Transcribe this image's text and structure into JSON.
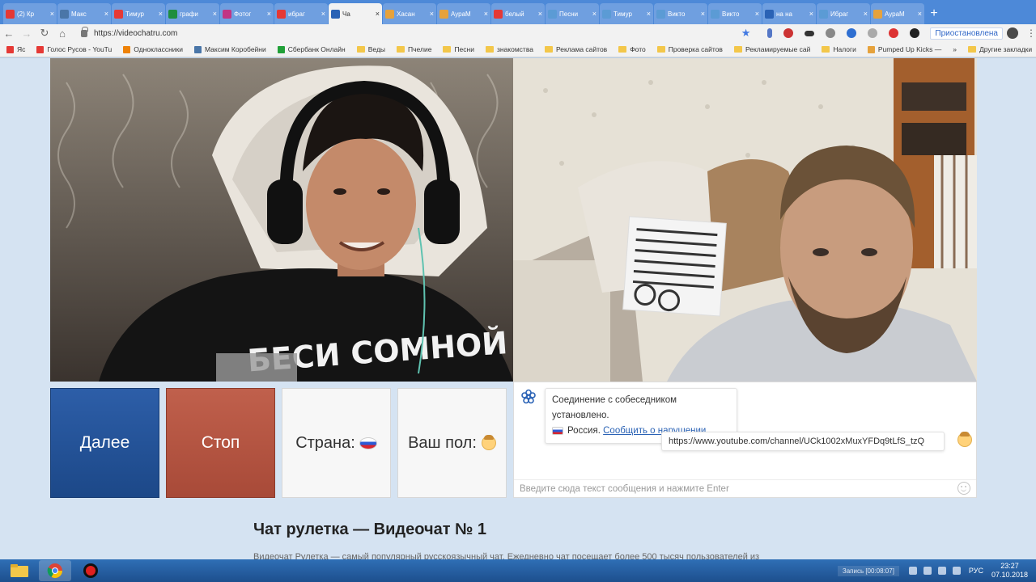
{
  "browser": {
    "tabs": [
      {
        "label": "(2) Кр",
        "icon": "youtube-icon",
        "color": "#e53935",
        "active": false
      },
      {
        "label": "Макс",
        "icon": "vk-icon",
        "color": "#4a76a8",
        "active": false
      },
      {
        "label": "Тимур",
        "icon": "youtube-icon",
        "color": "#e53935",
        "active": false
      },
      {
        "label": "графи",
        "icon": "sheets-icon",
        "color": "#1e8e3e",
        "active": false
      },
      {
        "label": "Фотог",
        "icon": "instagram-icon",
        "color": "#c13584",
        "active": false
      },
      {
        "label": "ибраг",
        "icon": "youtube-icon",
        "color": "#e53935",
        "active": false
      },
      {
        "label": "Ча",
        "icon": "videochat-icon",
        "color": "#2a62b5",
        "active": true
      },
      {
        "label": "Хасан",
        "icon": "pen-icon",
        "color": "#e6a23c",
        "active": false
      },
      {
        "label": "АураМ",
        "icon": "pen-icon",
        "color": "#e6a23c",
        "active": false
      },
      {
        "label": "белый",
        "icon": "yandex-icon",
        "color": "#e53935",
        "active": false
      },
      {
        "label": "Песни",
        "icon": "am-icon",
        "color": "#5b9bd5",
        "active": false
      },
      {
        "label": "Тимур",
        "icon": "am-icon",
        "color": "#5b9bd5",
        "active": false
      },
      {
        "label": "Викто",
        "icon": "am-icon",
        "color": "#5b9bd5",
        "active": false
      },
      {
        "label": "Викто",
        "icon": "am-icon",
        "color": "#5b9bd5",
        "active": false
      },
      {
        "label": "на на",
        "icon": "play-icon",
        "color": "#2a62b5",
        "active": false
      },
      {
        "label": "Ибраг",
        "icon": "am-icon",
        "color": "#5b9bd5",
        "active": false
      },
      {
        "label": "АураМ",
        "icon": "pen-icon",
        "color": "#e6a23c",
        "active": false
      }
    ],
    "url": "https://videochatru.com",
    "paused_label": "Приостановлена",
    "bookmarks": [
      {
        "label": "Яс",
        "kind": "yandex"
      },
      {
        "label": "Голос Русов - YouTu",
        "kind": "youtube"
      },
      {
        "label": "Одноклассники",
        "kind": "ok"
      },
      {
        "label": "Максим Коробейни",
        "kind": "vk"
      },
      {
        "label": "Сбербанк Онлайн",
        "kind": "sber"
      },
      {
        "label": "Веды",
        "kind": "folder"
      },
      {
        "label": "Пчелие",
        "kind": "folder"
      },
      {
        "label": "Песни",
        "kind": "folder"
      },
      {
        "label": "знакомства",
        "kind": "folder"
      },
      {
        "label": "Реклама сайтов",
        "kind": "folder"
      },
      {
        "label": "Фото",
        "kind": "folder"
      },
      {
        "label": "Проверка сайтов",
        "kind": "folder"
      },
      {
        "label": "Рекламируемые сай",
        "kind": "folder"
      },
      {
        "label": "Налоги",
        "kind": "folder"
      },
      {
        "label": "Pumped Up Kicks —",
        "kind": "pen"
      }
    ],
    "more_bookmarks_label": "»",
    "other_bookmarks_label": "Другие закладки"
  },
  "controls": {
    "next_label": "Далее",
    "stop_label": "Стоп",
    "country_label": "Страна:",
    "gender_label": "Ваш пол:"
  },
  "chat": {
    "system_message": "Соединение с собеседником установлено.",
    "country": "Россия.",
    "report_link": "Сообщить о нарушении",
    "report_suffix": ".",
    "user_message": "https://www.youtube.com/channel/UCk1002xMuxYFDq9tLfS_tzQ",
    "input_placeholder": "Введите сюда текст сообщения и нажмите Enter"
  },
  "page": {
    "heading": "Чат рулетка — Видеочат № 1",
    "intro": "Видеочат Рулетка — самый популярный русскоязычный чат. Ежедневно чат посещает более 500 тысяч пользователей из"
  },
  "taskbar": {
    "recording_label": "Запись [00:08:07]",
    "language": "РУС",
    "time": "23:27",
    "date": "07.10.2018"
  },
  "colors": {
    "next_button": "#1c4888",
    "stop_button": "#a84a38",
    "link": "#2a62b5"
  }
}
